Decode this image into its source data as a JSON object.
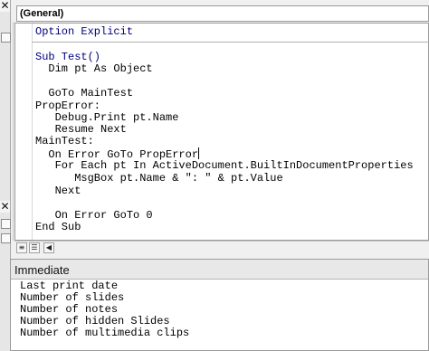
{
  "procedure_dropdown": {
    "value": "(General)"
  },
  "code_lines": [
    {
      "text": "Option Explicit"
    },
    {
      "text": ""
    },
    {
      "text": "Sub Test()"
    },
    {
      "text": "  Dim pt As Object"
    },
    {
      "text": ""
    },
    {
      "text": "  GoTo MainTest"
    },
    {
      "text": "PropError:"
    },
    {
      "text": "   Debug.Print pt.Name"
    },
    {
      "text": "   Resume Next"
    },
    {
      "text": "MainTest:"
    },
    {
      "text": "  On Error GoTo PropError"
    },
    {
      "text": "   For Each pt In ActiveDocument.BuiltInDocumentProperties"
    },
    {
      "text": "      MsgBox pt.Name & \": \" & pt.Value"
    },
    {
      "text": "   Next"
    },
    {
      "text": ""
    },
    {
      "text": "   On Error GoTo 0"
    },
    {
      "text": "End Sub"
    }
  ],
  "immediate": {
    "title": "Immediate",
    "lines": [
      "Last print date",
      "Number of slides",
      "Number of notes",
      "Number of hidden Slides",
      "Number of multimedia clips"
    ]
  },
  "icons": {
    "close": "close-icon",
    "procedure_view": "procedure-view-icon",
    "module_view": "full-module-view-icon",
    "scroll_left": "scroll-left-icon"
  },
  "colors": {
    "keyword": "#00007f",
    "text": "#000000"
  }
}
